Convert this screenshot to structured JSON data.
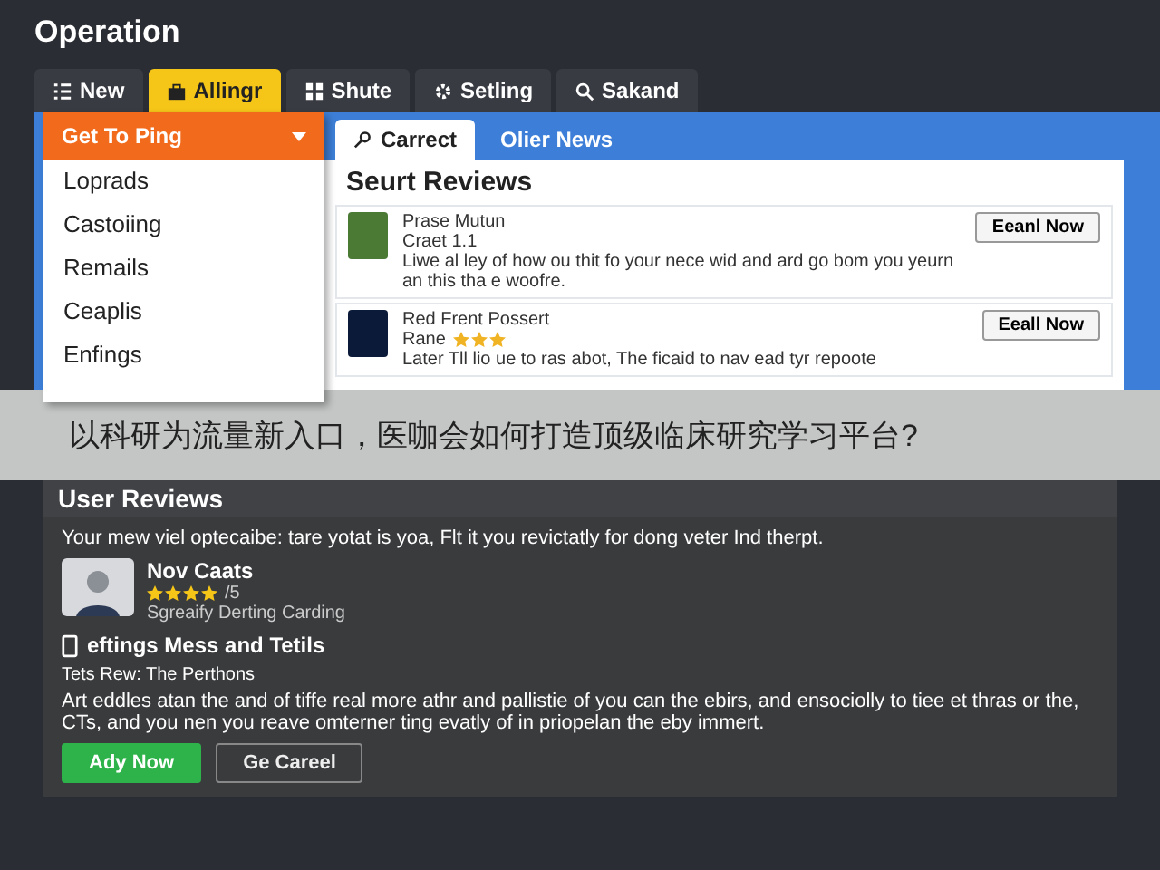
{
  "window": {
    "title": "Operation"
  },
  "tabs": [
    {
      "label": "New",
      "selected": false
    },
    {
      "label": "Allingr",
      "selected": true
    },
    {
      "label": "Shute",
      "selected": false
    },
    {
      "label": "Setling",
      "selected": false
    },
    {
      "label": "Sakand",
      "selected": false
    }
  ],
  "dropdown": {
    "label": "Get To Ping",
    "items": [
      "Loprads",
      "Castoiing",
      "Remails",
      "Ceaplis",
      "Enfings"
    ]
  },
  "subtabs": [
    {
      "label": "Carrect",
      "selected": true
    },
    {
      "label": "Olier News",
      "selected": false
    }
  ],
  "reviews_panel": {
    "title": "Seurt Reviews",
    "items": [
      {
        "name": "Prase Mutun",
        "meta": "Craet 1.1",
        "text": "Liwe al ley of how ou thit fo your nece wid and ard go bom you yeurn an this tha e woofre.",
        "button": "Eeanl Now"
      },
      {
        "name": "Red Frent Possert",
        "meta": "Rane",
        "stars": 3,
        "text": "Later Tll lio ue to ras abot, The ficaid to nav ead tyr repoote",
        "button": "Eeall Now"
      }
    ]
  },
  "caption": "以科研为流量新入口，医咖会如何打造顶级临床研究学习平台?",
  "user_reviews": {
    "title": "User Reviews",
    "intro": "Your mew viel optecaibe: tare yotat is yoa, Flt it you revictatly for dong veter Ind therpt.",
    "reviewer": {
      "name": "Nov Caats",
      "stars": 4,
      "rating": "/5",
      "role": "Sgreaify Derting Carding"
    },
    "heading": "eftings Mess and Tetils",
    "subtitle": "Tets Rew: The Perthons",
    "body": "Art eddles atan the and of tiffe real more athr and pallistie of you can the ebirs, and ensociolly to tiee et thras or the, CTs, and you nen you reave omterner ting evatly of in priopelan the eby immert.",
    "buttons": [
      {
        "label": "Ady Now",
        "kind": "primary"
      },
      {
        "label": "Ge Careel",
        "kind": "secondary"
      }
    ]
  }
}
